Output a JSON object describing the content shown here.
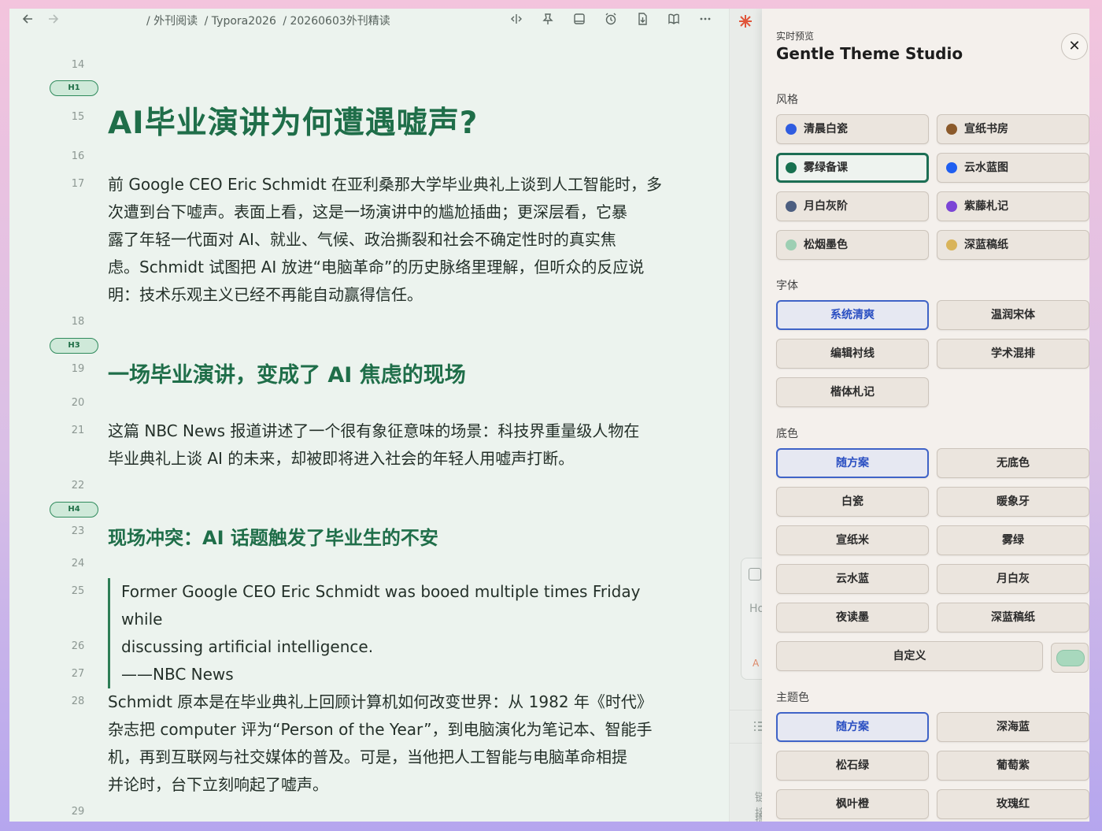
{
  "editor": {
    "breadcrumbs": [
      "/ 外刊阅读",
      "/ Typora2026",
      "/ 20260603外刊精读"
    ],
    "line_numbers": [
      "14",
      "15",
      "16",
      "17",
      "18",
      "19",
      "20",
      "21",
      "22",
      "23",
      "24",
      "25",
      "26",
      "27",
      "28",
      "29"
    ],
    "badges": [
      "H1",
      "H3",
      "H4"
    ],
    "h1": "AI毕业演讲为何遭遇嘘声?",
    "p1": [
      "前 Google CEO Eric Schmidt 在亚利桑那大学毕业典礼上谈到人工智能时，多",
      "次遭到台下嘘声。表面上看，这是一场演讲中的尴尬插曲；更深层看，它暴",
      "露了年轻一代面对 AI、就业、气候、政治撕裂和社会不确定性时的真实焦",
      "虑。Schmidt 试图把 AI 放进“电脑革命”的历史脉络里理解，但听众的反应说",
      "明：技术乐观主义已经不再能自动赢得信任。"
    ],
    "h3": "一场毕业演讲，变成了 AI 焦虑的现场",
    "p2": [
      "这篇 NBC News 报道讲述了一个很有象征意味的场景：科技界重量级人物在",
      "毕业典礼上谈 AI 的未来，却被即将进入社会的年轻人用嘘声打断。"
    ],
    "h4": "现场冲突：AI 话题触发了毕业生的不安",
    "quote": [
      "Former Google CEO Eric Schmidt was booed multiple times Friday while",
      "discussing artificial intelligence.",
      "——NBC News"
    ],
    "p3": [
      "Schmidt 原本是在毕业典礼上回顾计算机如何改变世界：从 1982 年《时代》",
      "杂志把 computer 评为“Person of the Year”，到电脑演化为笔记本、智能手",
      "机，再到互联网与社交媒体的普及。可是，当他把人工智能与电脑革命相提",
      "并论时，台下立刻响起了嘘声。"
    ]
  },
  "strip": {
    "card_text_1": "Ho",
    "card_text_2": "A",
    "link_text": "链接",
    "hint_text": "提示"
  },
  "panel": {
    "subtitle": "实时预览",
    "title": "Gentle Theme Studio",
    "close_label": "✕",
    "style_label": "风格",
    "styles": [
      {
        "label": "清晨白瓷",
        "color": "#2f5ce0"
      },
      {
        "label": "宣纸书房",
        "color": "#8b5a2b"
      },
      {
        "label": "雾绿备课",
        "color": "#17704f"
      },
      {
        "label": "云水蓝图",
        "color": "#1f5ef0"
      },
      {
        "label": "月白灰阶",
        "color": "#4c5e80"
      },
      {
        "label": "紫藤札记",
        "color": "#7b45d6"
      },
      {
        "label": "松烟墨色",
        "color": "#9dcfb3"
      },
      {
        "label": "深蓝稿纸",
        "color": "#d9b45a"
      }
    ],
    "font_label": "字体",
    "fonts": [
      "系统清爽",
      "温润宋体",
      "编辑衬线",
      "学术混排",
      "楷体札记"
    ],
    "bg_label": "底色",
    "bgs": [
      "随方案",
      "无底色",
      "白瓷",
      "暖象牙",
      "宣纸米",
      "雾绿",
      "云水蓝",
      "月白灰",
      "夜读墨",
      "深蓝稿纸"
    ],
    "bg_custom": "自定义",
    "theme_label": "主题色",
    "themes": [
      "随方案",
      "深海蓝",
      "松石绿",
      "葡萄紫",
      "枫叶橙",
      "玫瑰红"
    ]
  }
}
